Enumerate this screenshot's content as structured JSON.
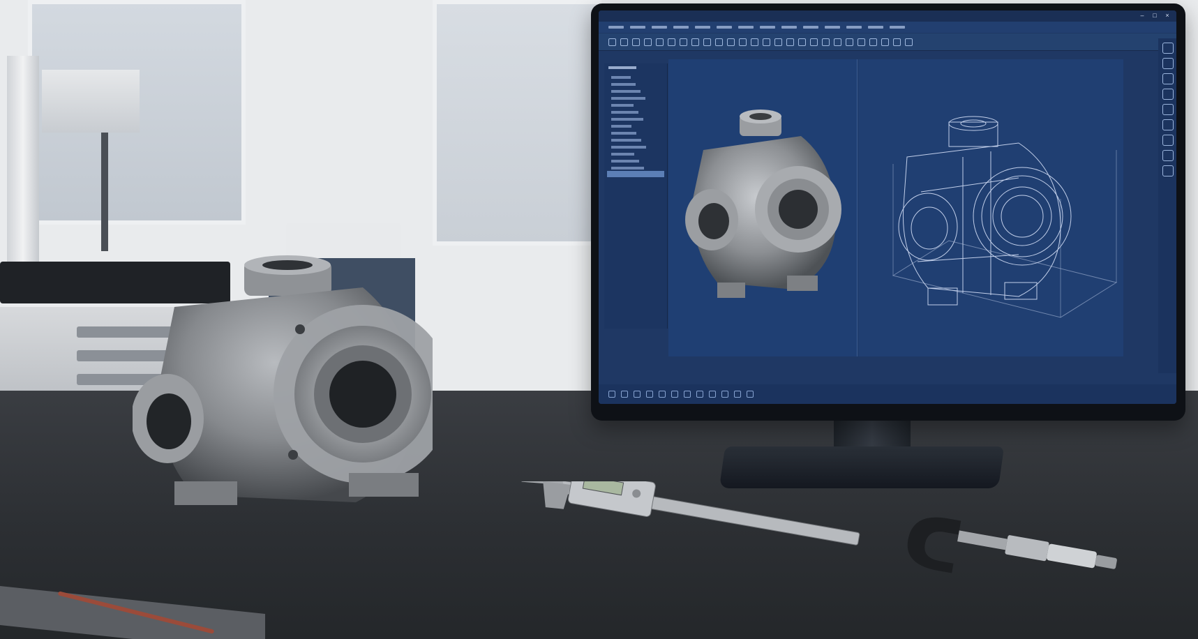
{
  "scene": {
    "description_objects": [
      "cast-metal-valve-housing",
      "digital-caliper",
      "micrometer",
      "monitor-cad-software"
    ]
  },
  "monitor": {
    "ui": {
      "window_controls": [
        "–",
        "□",
        "×"
      ],
      "tree_rows": 14,
      "toolbar_buttons": 26,
      "side_tools": 9
    }
  },
  "colors": {
    "screen_bg": "#1f3864",
    "desk": "#2c2f33",
    "metal": "#8c8f93",
    "wire": "#dfe9ff"
  },
  "caliper": {
    "display_value": ""
  }
}
